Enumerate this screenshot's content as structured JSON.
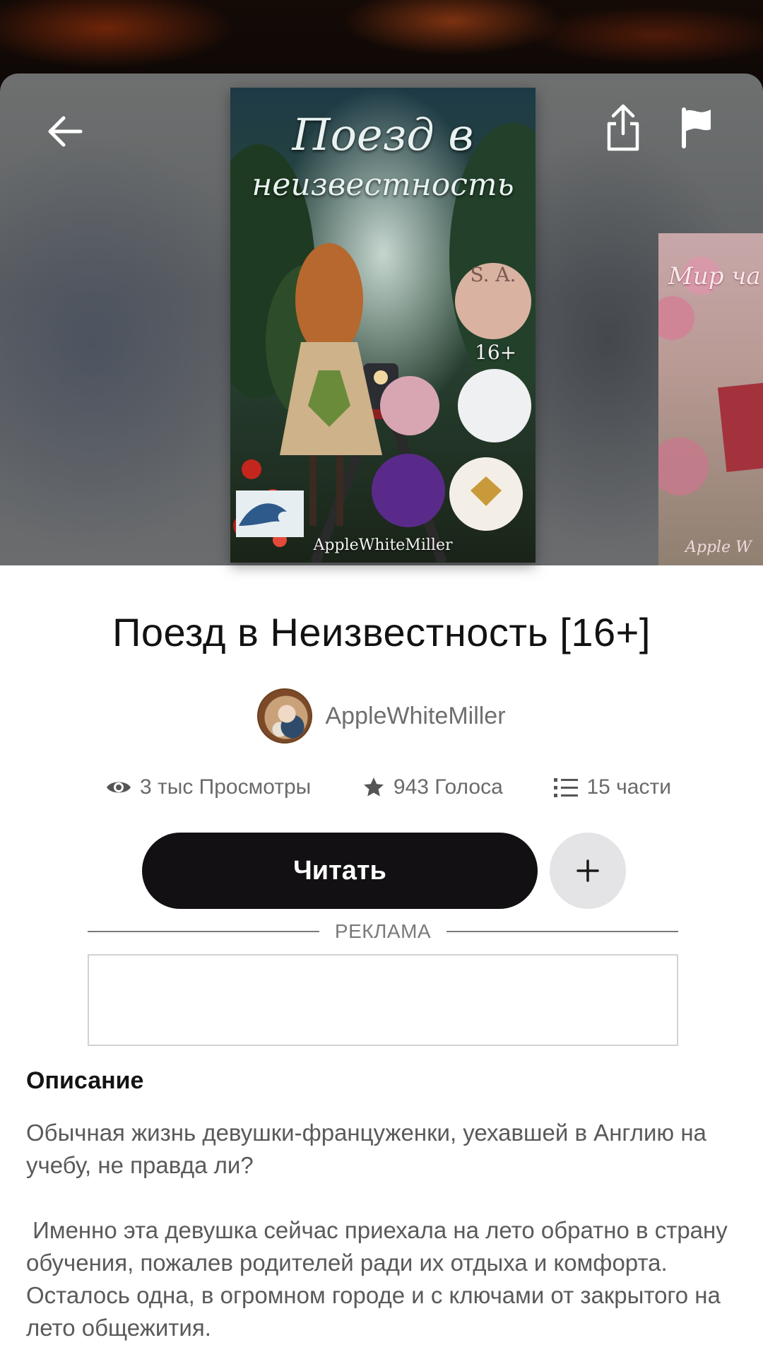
{
  "header": {
    "back_icon": "arrow-left-icon",
    "share_icon": "share-icon",
    "report_icon": "flag-icon"
  },
  "cover": {
    "title_line1": "Поезд в",
    "title_line2": "неизвестность",
    "rating": "16+",
    "badge": "S. A.",
    "author": "AppleWhiteMiller"
  },
  "next_cover": {
    "title": "Мир ча карт",
    "author": "Apple W"
  },
  "story": {
    "title": "Поезд в Неизвестность [16+]",
    "author": "AppleWhiteMiller"
  },
  "stats": {
    "views": "3 тыс Просмотры",
    "votes": "943 Голоса",
    "parts": "15 части"
  },
  "actions": {
    "read_label": "Читать",
    "add_label": "+"
  },
  "ad": {
    "label": "РЕКЛАМА"
  },
  "description": {
    "heading": "Описание",
    "paragraph1": "Обычная жизнь девушки-француженки, уехавшей в Англию на учебу, не правда ли?",
    "paragraph2": " Именно эта девушка сейчас приехала на лето обратно в страну обучения, пожалев родителей ради их отдыха и комфорта. Осталось одна, в огромном городе и с ключами от закрытого на лето общежития."
  },
  "colors": {
    "primary_button": "#121012",
    "secondary_button": "#e4e3e5",
    "text_muted": "#6a6a6a"
  }
}
